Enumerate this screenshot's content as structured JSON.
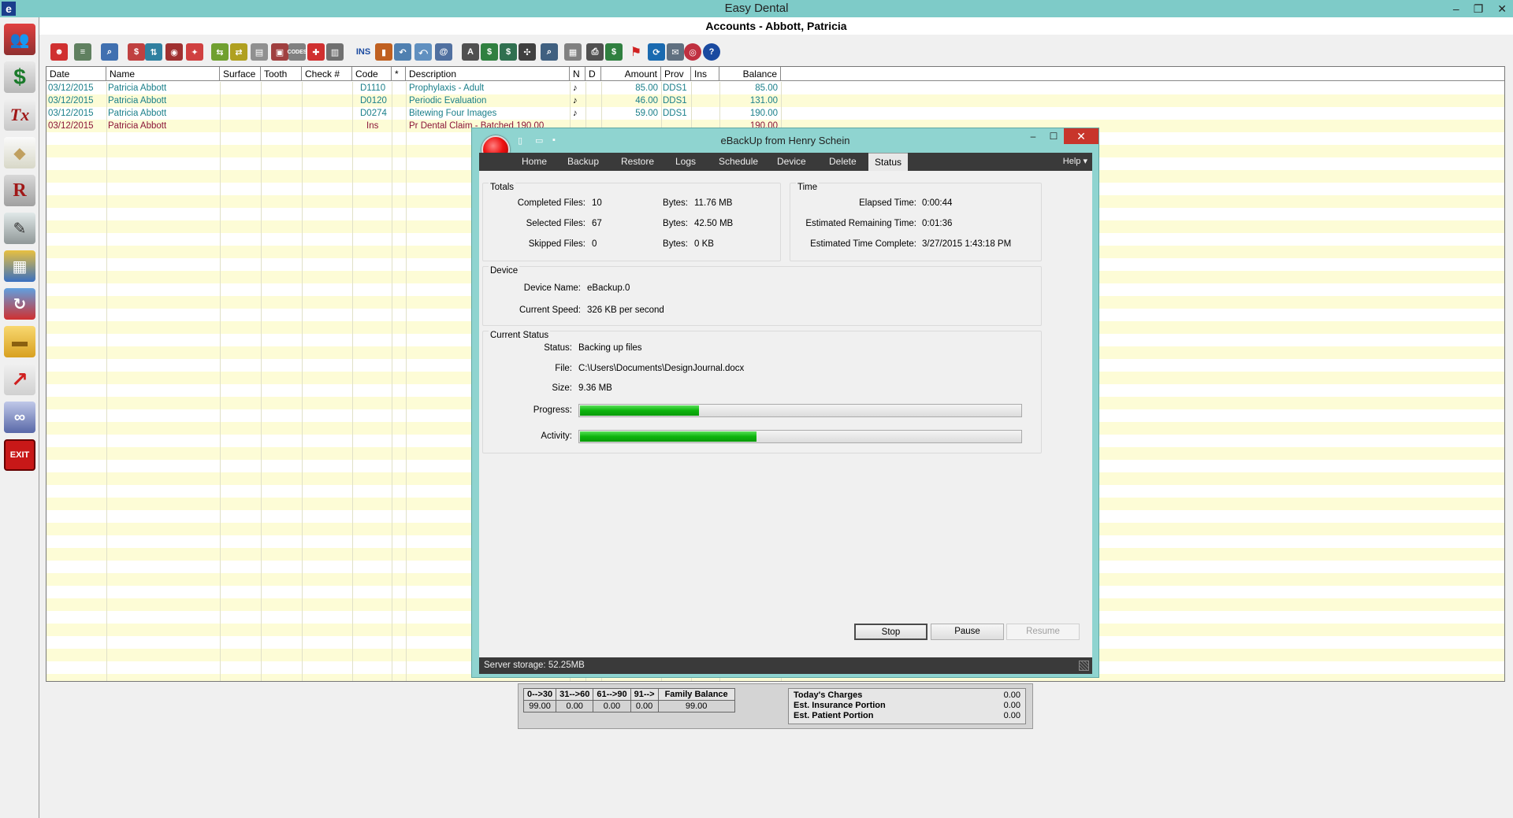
{
  "app": {
    "title": "Easy Dental",
    "logo": "e"
  },
  "window": {
    "minimize": "–",
    "restore": "❐",
    "close": "✕"
  },
  "document": {
    "title": "Accounts - Abbott, Patricia"
  },
  "sidebar": {
    "icons": [
      "family-icon",
      "dollar-icon",
      "treatment-icon",
      "tooth-icon",
      "prescription-icon",
      "notes-icon",
      "charts-icon",
      "pen-refresh-icon",
      "folder-icon",
      "trend-arrow-icon",
      "ribbon-icon",
      "exit-icon"
    ],
    "labels": {
      "tx": "Tx",
      "rx": "R",
      "exit": "EXIT",
      "dollar": "$"
    }
  },
  "toolbar": {
    "ins_label": "INS",
    "codes_label": "CODES"
  },
  "ledger": {
    "columns": [
      "Date",
      "Name",
      "Surface",
      "Tooth",
      "Check #",
      "Code",
      "*",
      "Description",
      "N",
      "D",
      "Amount",
      "Prov",
      "Ins",
      "Balance"
    ],
    "rows": [
      {
        "date": "03/12/2015",
        "name": "Patricia  Abbott",
        "code": "D1110",
        "description": "Prophylaxis - Adult",
        "n": "♪",
        "amount": "85.00",
        "prov": "DDS1",
        "balance": "85.00",
        "color": "teal"
      },
      {
        "date": "03/12/2015",
        "name": "Patricia  Abbott",
        "code": "D0120",
        "description": "Periodic Evaluation",
        "n": "♪",
        "amount": "46.00",
        "prov": "DDS1",
        "balance": "131.00",
        "color": "teal"
      },
      {
        "date": "03/12/2015",
        "name": "Patricia  Abbott",
        "code": "D0274",
        "description": "Bitewing Four Images",
        "n": "♪",
        "amount": "59.00",
        "prov": "DDS1",
        "balance": "190.00",
        "color": "teal"
      },
      {
        "date": "03/12/2015",
        "name": "Patricia  Abbott",
        "code": "Ins",
        "description": "Pr Dental Claim - Batched 190.00",
        "n": "",
        "amount": "",
        "prov": "",
        "balance": "190.00",
        "color": "maroon"
      }
    ]
  },
  "aging": {
    "headers": [
      "0-->30",
      "31-->60",
      "61-->90",
      "91-->",
      "Family Balance"
    ],
    "values": [
      "99.00",
      "0.00",
      "0.00",
      "0.00",
      "99.00"
    ],
    "charges": [
      {
        "label": "Today's Charges",
        "value": "0.00"
      },
      {
        "label": "Est. Insurance Portion",
        "value": "0.00"
      },
      {
        "label": "Est. Patient Portion",
        "value": "0.00"
      }
    ]
  },
  "ebackup": {
    "title": "eBackUp from Henry Schein",
    "tabs": [
      "Home",
      "Backup",
      "Restore",
      "Logs",
      "Schedule",
      "Device",
      "Delete",
      "Status"
    ],
    "active_tab": "Status",
    "help": "Help ▾",
    "totals": {
      "heading": "Totals",
      "completed_files_label": "Completed Files:",
      "completed_files": "10",
      "selected_files_label": "Selected Files:",
      "selected_files": "67",
      "skipped_files_label": "Skipped Files:",
      "skipped_files": "0",
      "bytes_label": "Bytes:",
      "completed_bytes": "11.76 MB",
      "selected_bytes": "42.50 MB",
      "skipped_bytes": "0 KB"
    },
    "time": {
      "heading": "Time",
      "elapsed_label": "Elapsed Time:",
      "elapsed": "0:00:44",
      "remaining_label": "Estimated Remaining Time:",
      "remaining": "0:01:36",
      "complete_label": "Estimated Time Complete:",
      "complete": "3/27/2015 1:43:18 PM"
    },
    "device": {
      "heading": "Device",
      "name_label": "Device Name:",
      "name": "eBackup.0",
      "speed_label": "Current Speed:",
      "speed": "326 KB per second"
    },
    "current": {
      "heading": "Current Status",
      "status_label": "Status:",
      "status": "Backing up files",
      "file_label": "File:",
      "file": "C:\\Users\\Documents\\DesignJournal.docx",
      "size_label": "Size:",
      "size": "9.36 MB",
      "progress_label": "Progress:",
      "progress_fraction": 0.27,
      "activity_label": "Activity:",
      "activity_fraction": 0.4
    },
    "buttons": {
      "stop": "Stop",
      "pause": "Pause",
      "resume": "Resume"
    },
    "status_bar": "Server storage: 52.25MB"
  }
}
